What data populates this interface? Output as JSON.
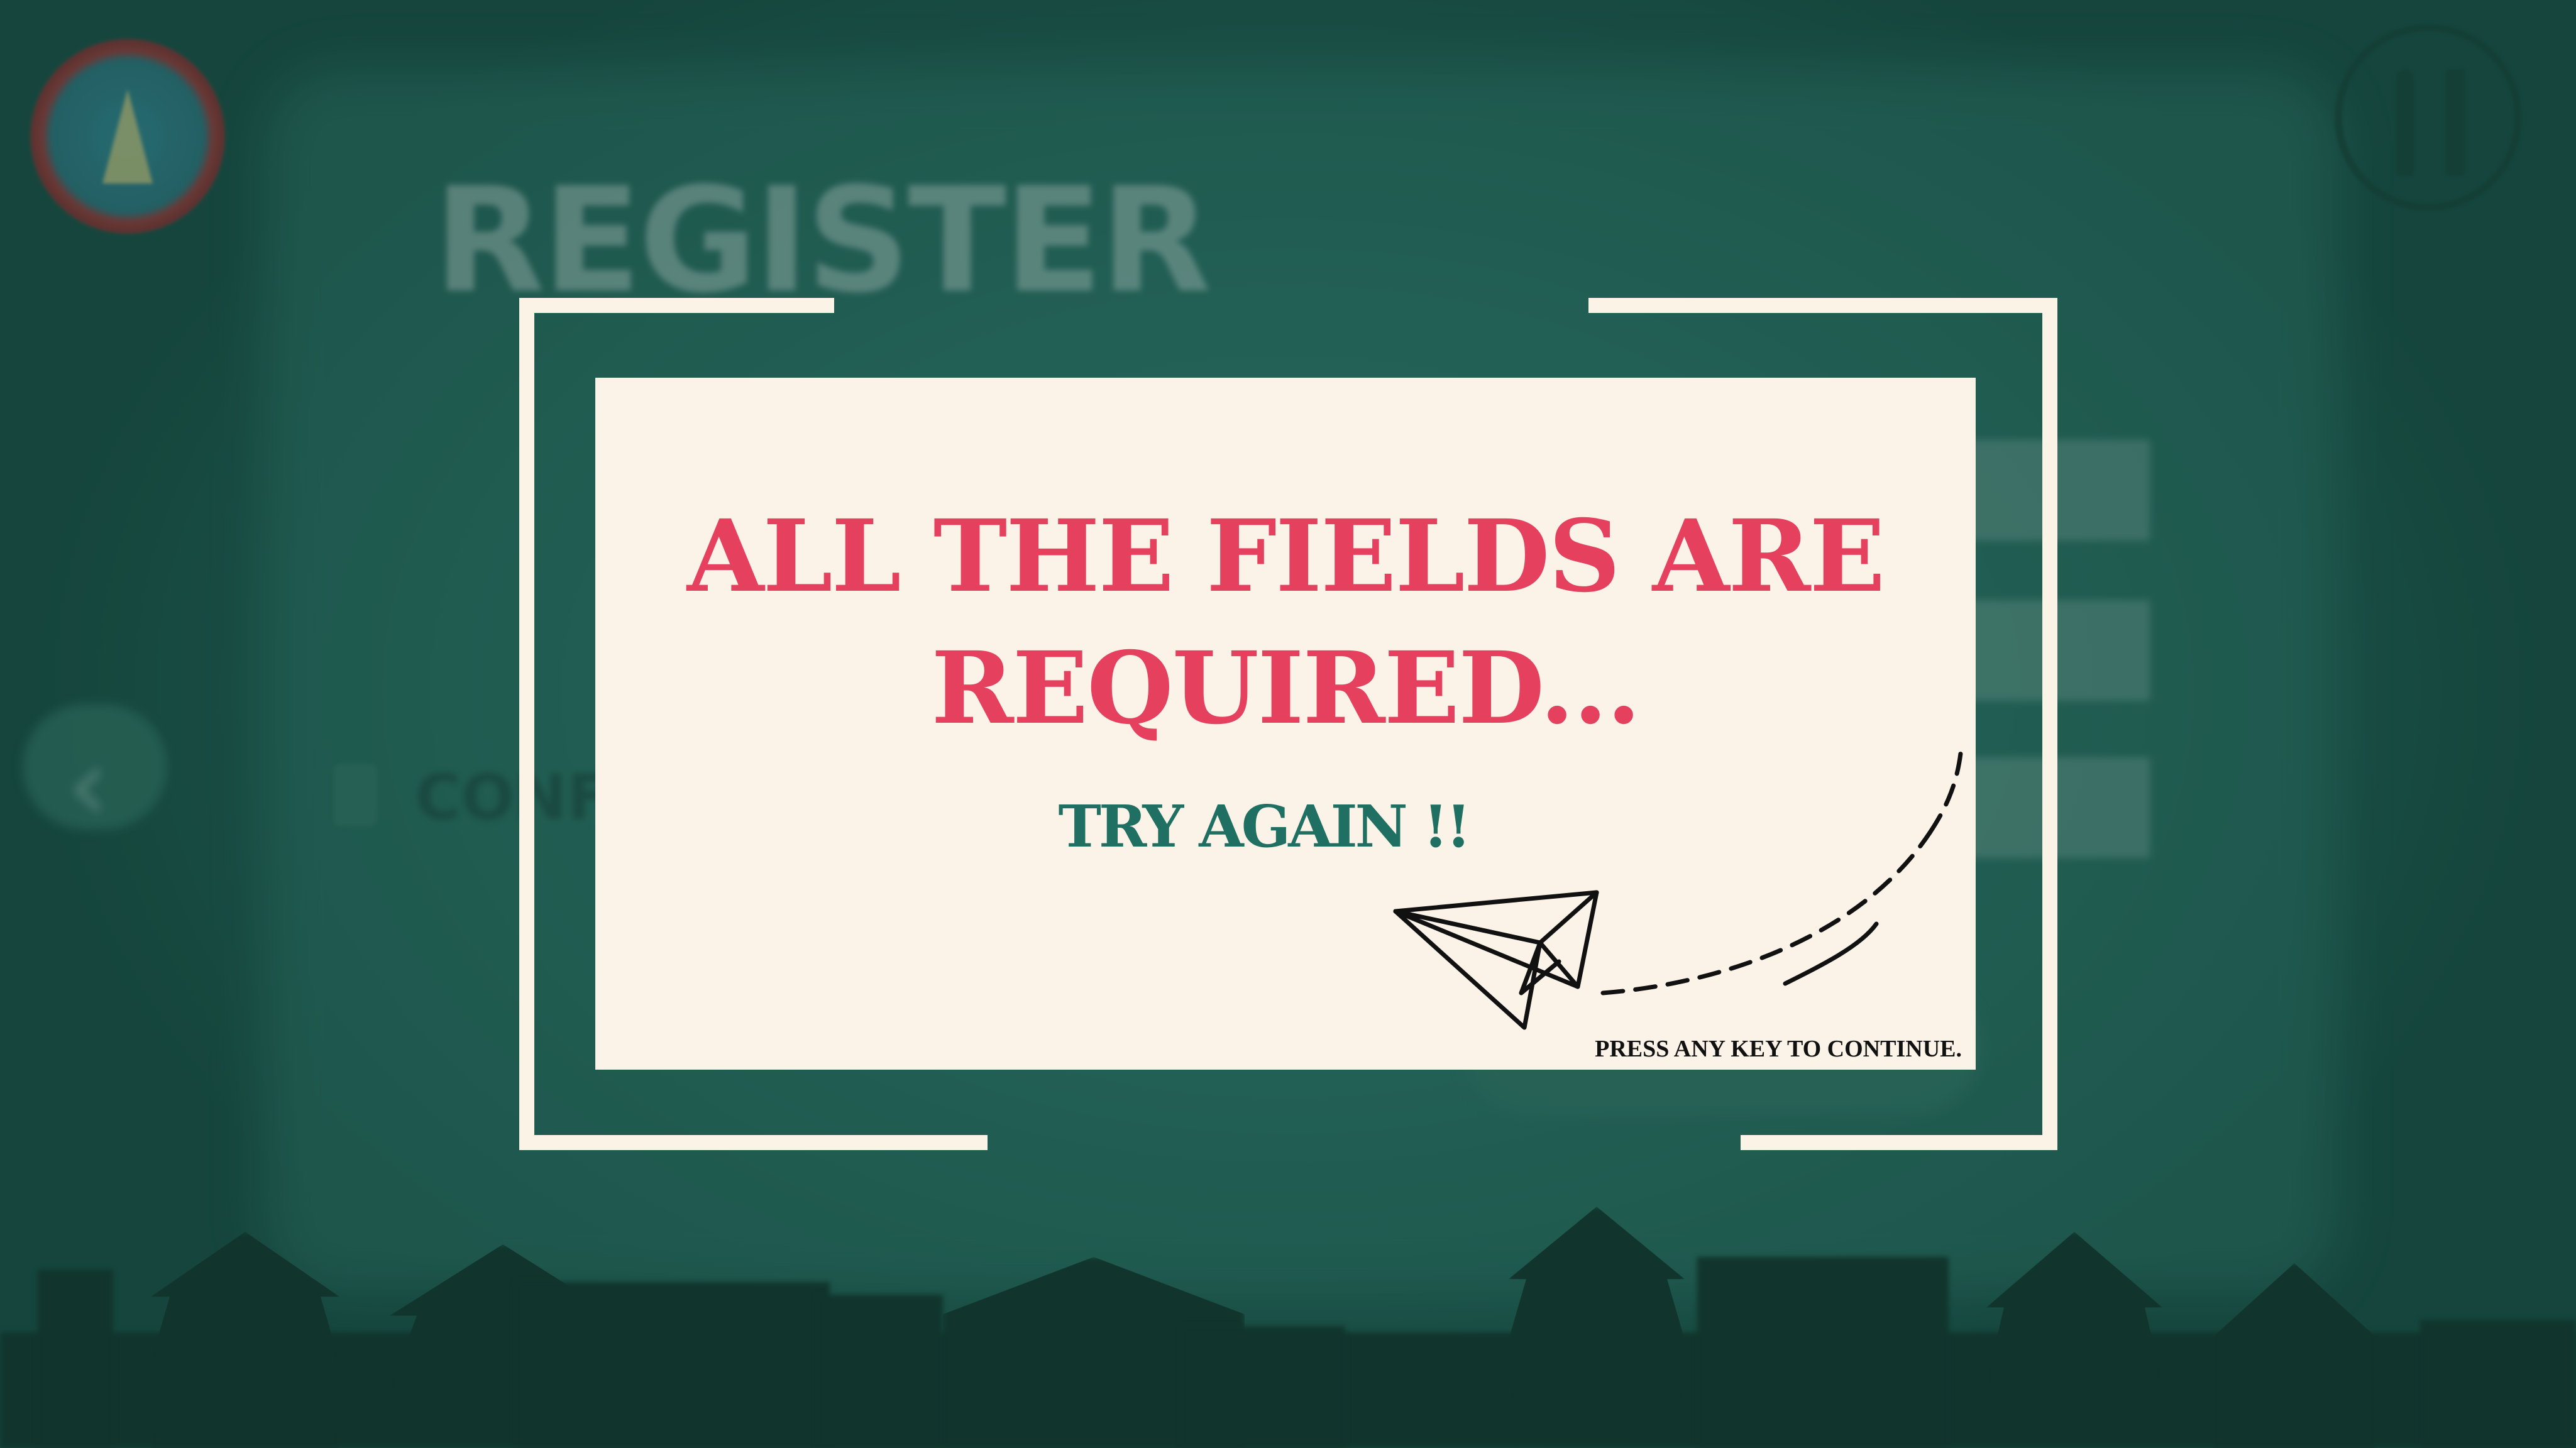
{
  "background": {
    "screen_title": "REGISTER",
    "partial_field_label": "CONF",
    "back_icon": "chevron-left-icon",
    "left_logo_icon": "emblem-icon",
    "right_logo_icon": "spoon-fork-icon"
  },
  "dialog": {
    "title_line1": "ALL THE FIELDS ARE",
    "title_line2": "REQUIRED...",
    "subtitle": "TRY  AGAIN !!",
    "footer_hint": "PRESS ANY KEY TO CONTINUE.",
    "illustration_icon": "paper-plane-icon"
  },
  "colors": {
    "background": "#1e5a50",
    "card": "#fbf3e8",
    "title": "#e5405e",
    "subtitle": "#1f6f62",
    "frame": "#fbf3e6"
  }
}
